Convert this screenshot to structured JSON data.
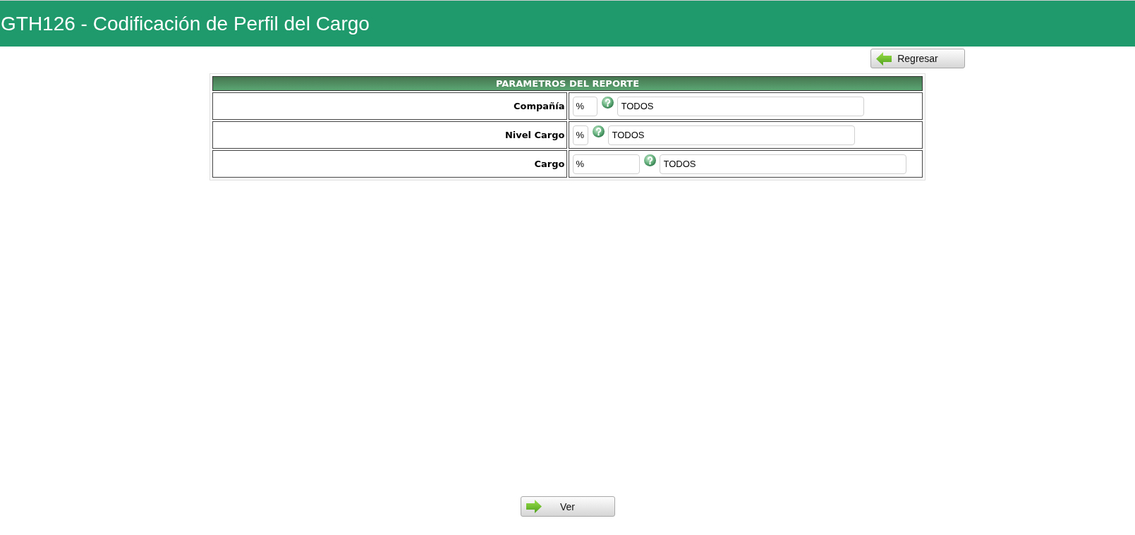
{
  "header": {
    "title": "GTH126 - Codificación de Perfil del Cargo"
  },
  "toolbar": {
    "back_button": "Regresar"
  },
  "parameters": {
    "title": "PARAMETROS DEL REPORTE",
    "rows": [
      {
        "label": "Compañía",
        "code": "%",
        "description": "TODOS"
      },
      {
        "label": "Nivel Cargo",
        "code": "%",
        "description": "TODOS"
      },
      {
        "label": "Cargo",
        "code": "%",
        "description": "TODOS"
      }
    ]
  },
  "footer": {
    "view_button": "Ver"
  }
}
